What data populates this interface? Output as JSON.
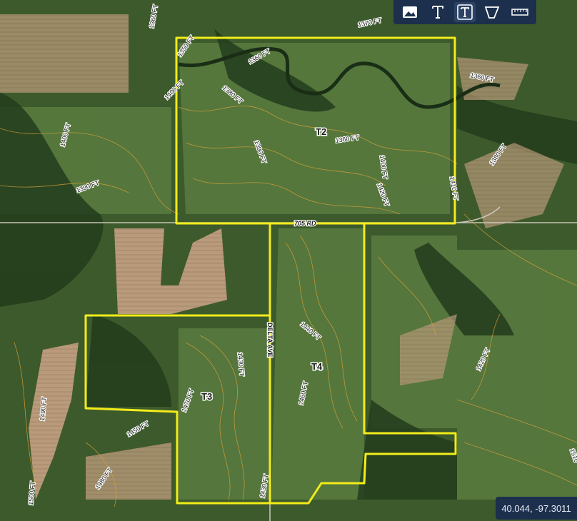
{
  "toolbar": {
    "tools": [
      {
        "name": "image-layer",
        "icon": "image-icon"
      },
      {
        "name": "text-tool",
        "icon": "text-icon"
      },
      {
        "name": "text-box-tool",
        "icon": "text-box-icon"
      },
      {
        "name": "polygon-tool",
        "icon": "polygon-icon"
      },
      {
        "name": "measure-tool",
        "icon": "ruler-icon"
      }
    ]
  },
  "coordinates": "40.044, -97.3011",
  "tracts": {
    "t2": "T2",
    "t3": "T3",
    "t4": "T4"
  },
  "roads": {
    "road_705": "705 RD",
    "delta": "DELTA AVE"
  },
  "contours": {
    "c1": "1360 FT",
    "c2": "1370 FT",
    "c3": "1350 FT",
    "c4": "1360 FT",
    "c5": "1400 FT",
    "c6": "1380 FT",
    "c7": "1360 FT",
    "c8": "1400 FT",
    "c9": "1390 FT",
    "c10": "1390 FT",
    "c11": "1360 FT",
    "c12": "1400 FT",
    "c13": "1420 FT",
    "c14": "1380 FT",
    "c15": "1410 FT",
    "c16": "1440 FT",
    "c17": "1430 FT",
    "c18": "1460 FT",
    "c19": "1470 FT",
    "c20": "1420 FT",
    "c21": "1490 FT",
    "c22": "1450 FT",
    "c23": "1480 FT",
    "c24": "1500 FT",
    "c25": "1430 FT",
    "c26": "1510"
  },
  "colors": {
    "boundary": "#f2ec1a",
    "contour": "#d9a23a",
    "toolbar": "#1c2f4d"
  }
}
